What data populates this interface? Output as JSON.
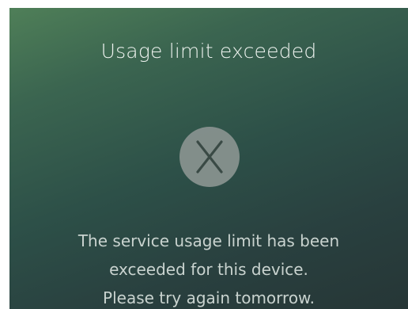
{
  "dialog": {
    "title": "Usage limit exceeded",
    "icon": "close-x-circle-icon",
    "message_lines": [
      "The service usage limit has been",
      "exceeded for this device.",
      "Please try again tomorrow."
    ]
  },
  "colors": {
    "gradient_top": "#4f7f58",
    "gradient_bottom": "#263636",
    "icon_circle": "#8a9490",
    "icon_x": "#3a4a45",
    "title_text": "#eef3ef",
    "message_text": "#c9d3cf"
  }
}
